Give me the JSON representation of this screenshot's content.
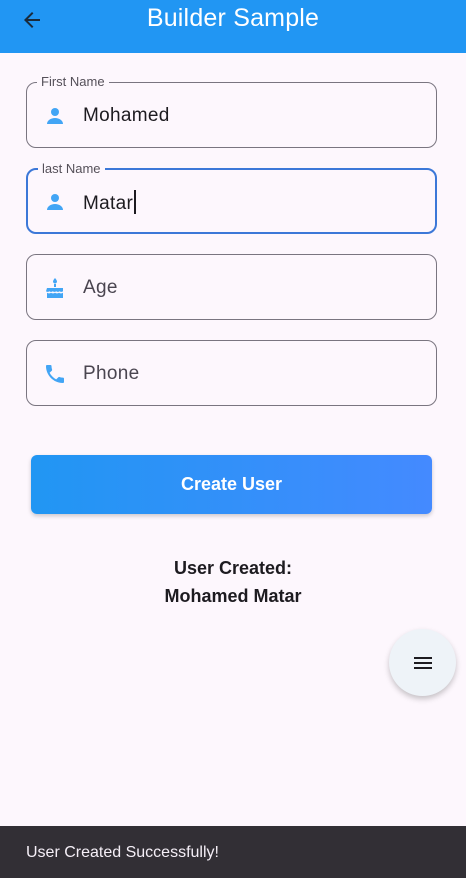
{
  "app_bar": {
    "title": "Builder Sample",
    "back_icon": "arrow-back-icon",
    "color": "#2196f3"
  },
  "form": {
    "first_name": {
      "label": "First Name",
      "value": "Mohamed",
      "icon": "person-icon"
    },
    "last_name": {
      "label": "last Name",
      "value": "Matar",
      "icon": "person-icon",
      "focused": true
    },
    "age": {
      "placeholder": "Age",
      "value": "",
      "icon": "cake-icon"
    },
    "phone": {
      "placeholder": "Phone",
      "value": "",
      "icon": "phone-icon"
    }
  },
  "create_button": {
    "label": "Create User"
  },
  "result": {
    "heading": "User Created:",
    "name": "Mohamed Matar"
  },
  "fab": {
    "icon": "menu-icon"
  },
  "snackbar": {
    "message": "User Created Successfully!"
  },
  "colors": {
    "accent": "#2196f3",
    "icon": "#42a5f5",
    "focus_border": "#3c78d8",
    "background": "#fdf7fd"
  }
}
